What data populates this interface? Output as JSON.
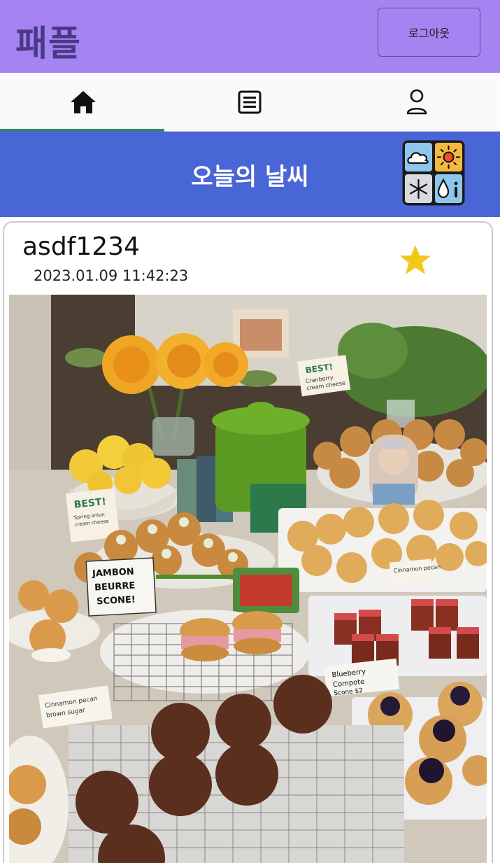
{
  "header": {
    "brand": "패플",
    "logout_label": "로그아웃"
  },
  "tabs": [
    {
      "icon": "home-icon",
      "active": true
    },
    {
      "icon": "list-icon",
      "active": false
    },
    {
      "icon": "profile-icon",
      "active": false
    }
  ],
  "weather_banner": {
    "title": "오늘의 날씨",
    "icon": "weather-grid-icon"
  },
  "post": {
    "username": "asdf1234",
    "datetime": "2023.01.09 11:42:23",
    "favorite_icon": "star-icon",
    "image": {
      "signs": [
        "JAMBON BEURRE SCONE!",
        "BEST!",
        "Blueberry Compote Scone $2",
        "Cinnamon pecan"
      ]
    }
  },
  "colors": {
    "header_bg": "#a583f0",
    "brand_text": "#4a3a86",
    "weather_bg": "#4966d6",
    "active_tab_indicator": "#3d7f72",
    "star": "#f5c518"
  }
}
